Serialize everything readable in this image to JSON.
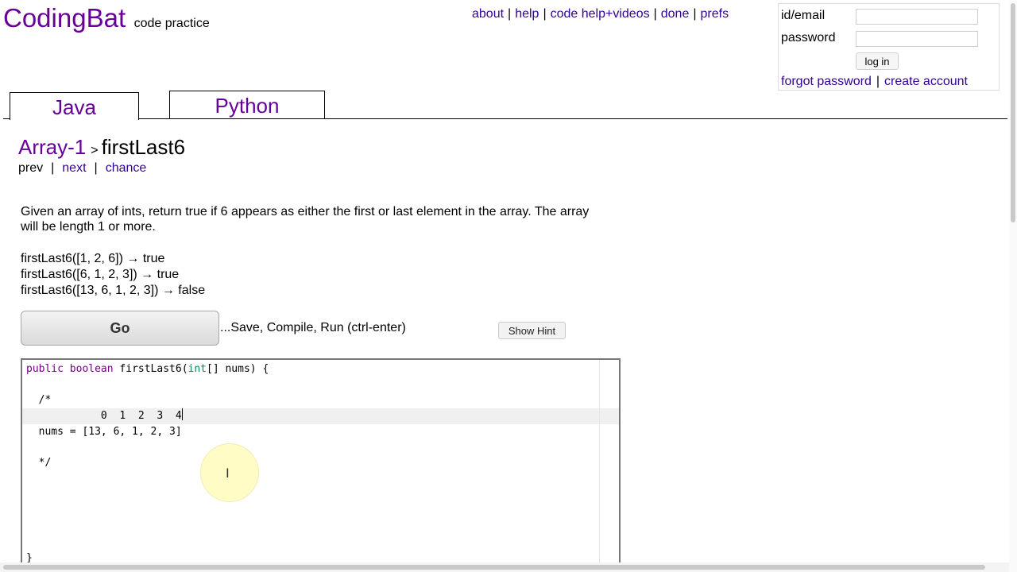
{
  "header": {
    "brand": "CodingBat",
    "tagline": "code practice",
    "nav": [
      "about",
      "help",
      "code help+videos",
      "done",
      "prefs"
    ]
  },
  "login": {
    "id_label": "id/email",
    "password_label": "password",
    "id_value": "",
    "password_value": "",
    "button": "log in",
    "forgot": "forgot password",
    "create": "create account"
  },
  "tabs": [
    "Java",
    "Python"
  ],
  "problem": {
    "section": "Array-1",
    "separator": ">",
    "name": "firstLast6",
    "nav": {
      "prev": "prev",
      "next": "next",
      "chance": "chance"
    },
    "description": "Given an array of ints, return true if 6 appears as either the first or last element in the array. The array will be length 1 or more.",
    "examples": [
      "firstLast6([1, 2, 6]) → true",
      "firstLast6([6, 1, 2, 3]) → true",
      "firstLast6([13, 6, 1, 2, 3]) → false"
    ]
  },
  "actions": {
    "go": "Go",
    "caption": "...Save, Compile, Run (ctrl-enter)",
    "hint": "Show Hint"
  },
  "editor": {
    "sig_kw1": "public",
    "sig_kw2": "boolean",
    "sig_name": "firstLast6(",
    "sig_type": "int",
    "sig_rest": "[] nums) {",
    "comment_open": "  /*",
    "indices": "            0  1  2  3  4",
    "array_line": "  nums = [13, 6, 1, 2, 3]",
    "comment_close": "  */",
    "closing": "}"
  },
  "colors": {
    "link": "#330099",
    "brand": "#660099",
    "keyword": "#770088",
    "comment": "#228811"
  }
}
